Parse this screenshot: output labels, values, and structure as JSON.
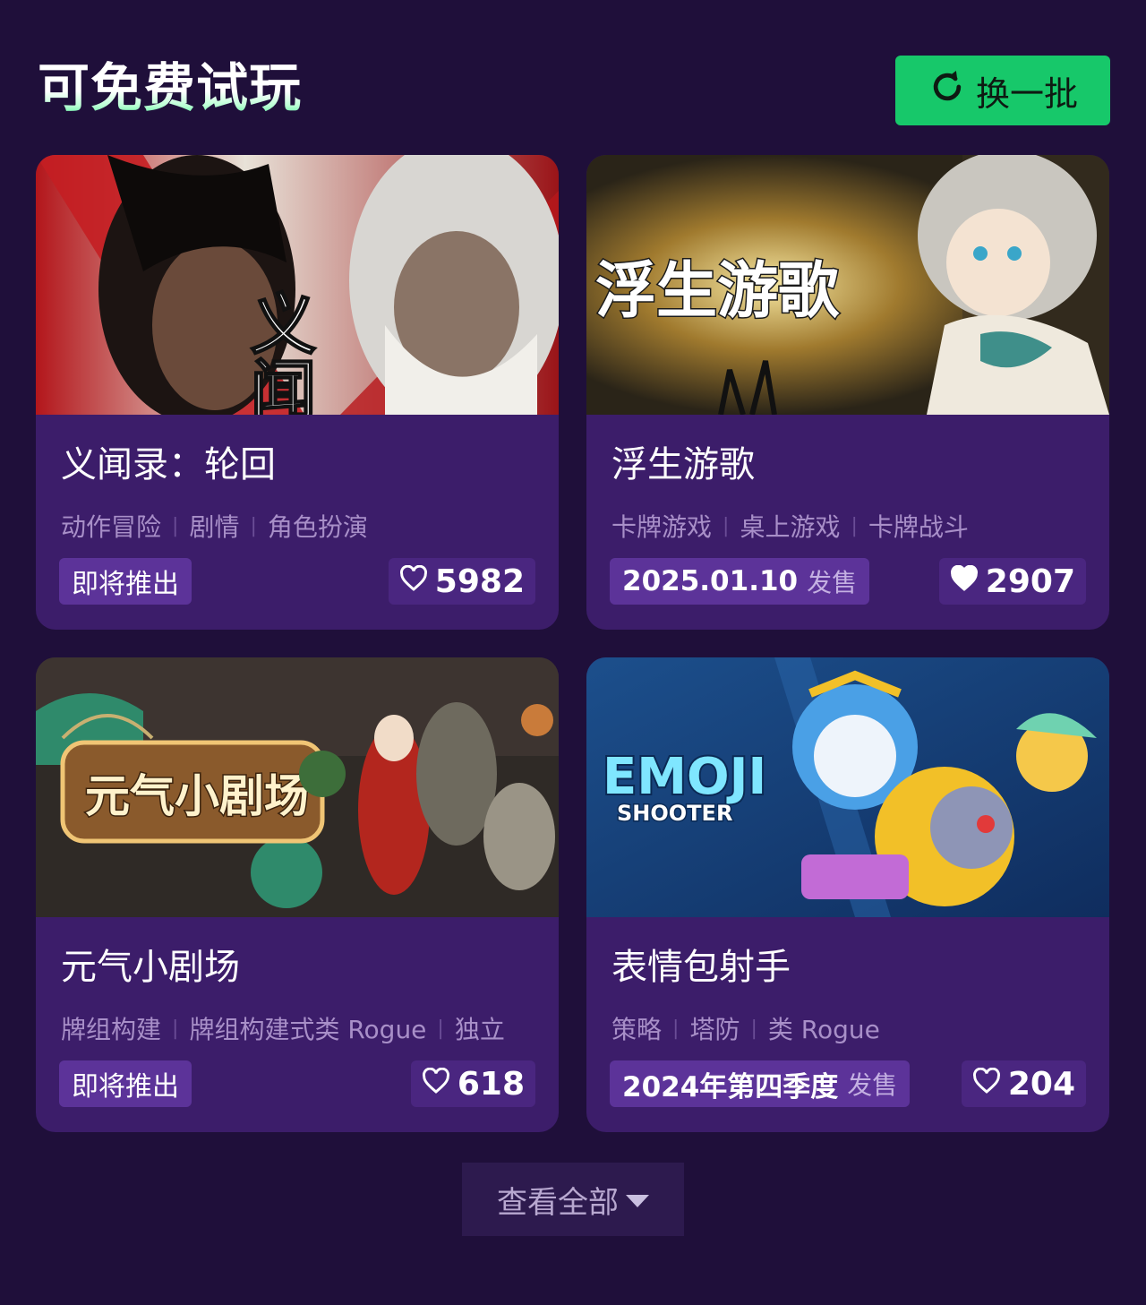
{
  "section": {
    "title": "可免费试玩",
    "refresh_label": "换一批",
    "refresh_icon": "refresh-icon",
    "view_all_label": "查看全部",
    "view_all_icon": "caret-down-icon"
  },
  "colors": {
    "background": "#1f0f3a",
    "card": "#3c1d6a",
    "accent_green": "#17c86a",
    "badge": "#5c3399"
  },
  "games": [
    {
      "name": "义闻录：轮回",
      "cover_logo_text": "义闻录",
      "tags": [
        "动作冒险",
        "剧情",
        "角色扮演"
      ],
      "status": "即将推出",
      "status_suffix": "",
      "likes": "5982",
      "liked": false
    },
    {
      "name": "浮生游歌",
      "cover_logo_text": "浮生游歌",
      "tags": [
        "卡牌游戏",
        "桌上游戏",
        "卡牌战斗"
      ],
      "status": "2025.01.10",
      "status_suffix": "发售",
      "likes": "2907",
      "liked": true
    },
    {
      "name": "元气小剧场",
      "cover_logo_text": "元气小剧场",
      "tags": [
        "牌组构建",
        "牌组构建式类 Rogue",
        "独立"
      ],
      "status": "即将推出",
      "status_suffix": "",
      "likes": "618",
      "liked": false
    },
    {
      "name": "表情包射手",
      "cover_logo_text": "EMOJI",
      "cover_logo_sub": "SHOOTER",
      "tags": [
        "策略",
        "塔防",
        "类 Rogue"
      ],
      "status": "2024年第四季度",
      "status_suffix": "发售",
      "likes": "204",
      "liked": false
    }
  ]
}
